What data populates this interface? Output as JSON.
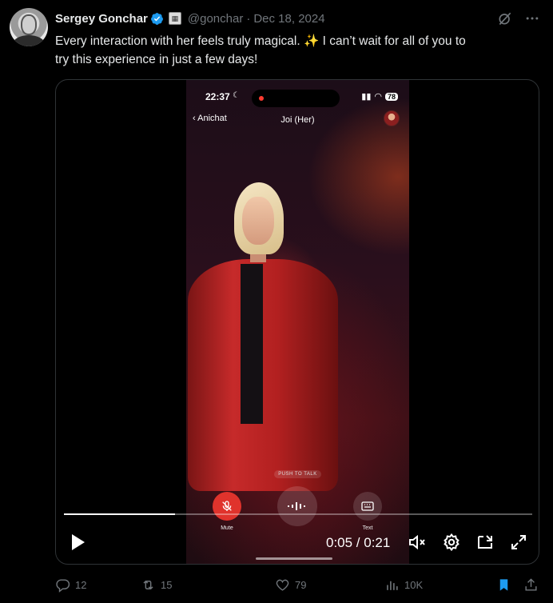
{
  "tweet": {
    "author_name": "Sergey Gonchar",
    "handle": "@gonchar",
    "separator": "·",
    "date": "Dec 18, 2024",
    "text_line1": "Every interaction with her feels truly magical. ✨ I can’t wait for all of you to",
    "text_line2": "try this experience in just a few days!"
  },
  "video_screen": {
    "status_time": "22:37",
    "battery": "78",
    "back_label": "Anichat",
    "chat_title": "Joi (Her)",
    "push_to_talk": "PUSH TO TALK",
    "mute_label": "Mute",
    "text_label": "Text"
  },
  "player": {
    "timecode": "0:05 / 0:21",
    "progress_fraction": 0.238
  },
  "actions": {
    "replies": "12",
    "reposts": "15",
    "likes": "79",
    "views": "10K"
  },
  "colors": {
    "accent": "#1d9bf0",
    "muted_text": "#71767b",
    "mute_red": "#e0332c"
  }
}
